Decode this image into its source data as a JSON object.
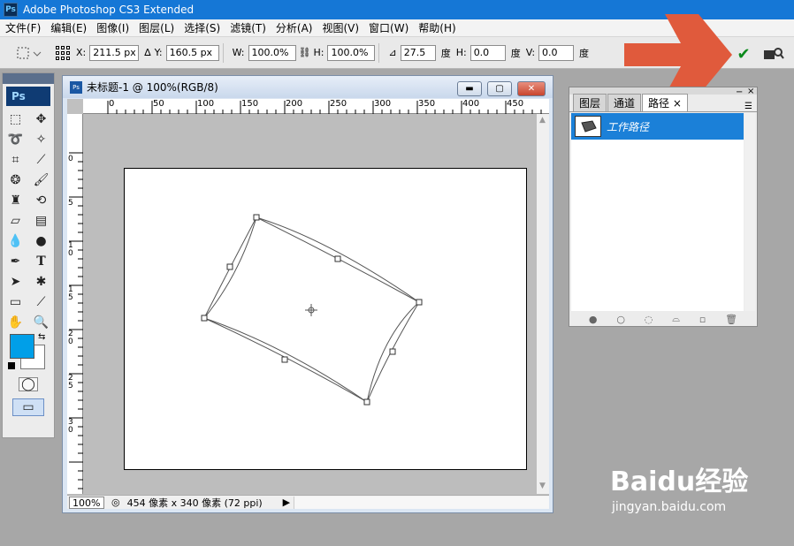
{
  "app": {
    "title": "Adobe Photoshop CS3 Extended",
    "logo": "Ps"
  },
  "menu": [
    "文件(F)",
    "编辑(E)",
    "图像(I)",
    "图层(L)",
    "选择(S)",
    "滤镜(T)",
    "分析(A)",
    "视图(V)",
    "窗口(W)",
    "帮助(H)"
  ],
  "options": {
    "x_label": "X:",
    "x_value": "211.5 px",
    "y_label": "Y:",
    "y_value": "160.5 px",
    "w_label": "W:",
    "w_value": "100.0%",
    "h_label": "H:",
    "h_value": "100.0%",
    "angle_value": "27.5",
    "angle_unit": "度",
    "hskew_label": "H:",
    "hskew_value": "0.0",
    "hskew_unit": "度",
    "vskew_label": "V:",
    "vskew_value": "0.0",
    "vskew_unit": "度"
  },
  "document": {
    "title": "未标题-1 @ 100%(RGB/8)",
    "zoom": "100%",
    "status": "454 像素 x 340 像素 (72 ppi)",
    "ruler_top": [
      "0",
      "50",
      "100",
      "150",
      "200",
      "250",
      "300",
      "350",
      "400",
      "450"
    ],
    "ruler_left": [
      "0",
      "5",
      "1\n0",
      "1\n5",
      "2\n0",
      "2\n5",
      "3\n0"
    ]
  },
  "panel": {
    "tabs": [
      "图层",
      "通道",
      "路径"
    ],
    "active_tab": "路径",
    "path_name": "工作路径"
  },
  "colors": {
    "foreground": "#009fe8",
    "background": "#ffffff",
    "arrow": "#e05a3c",
    "selection": "#1b80d8"
  },
  "watermark": {
    "line1": "Baidu经验",
    "line2": "jingyan.baidu.com"
  }
}
